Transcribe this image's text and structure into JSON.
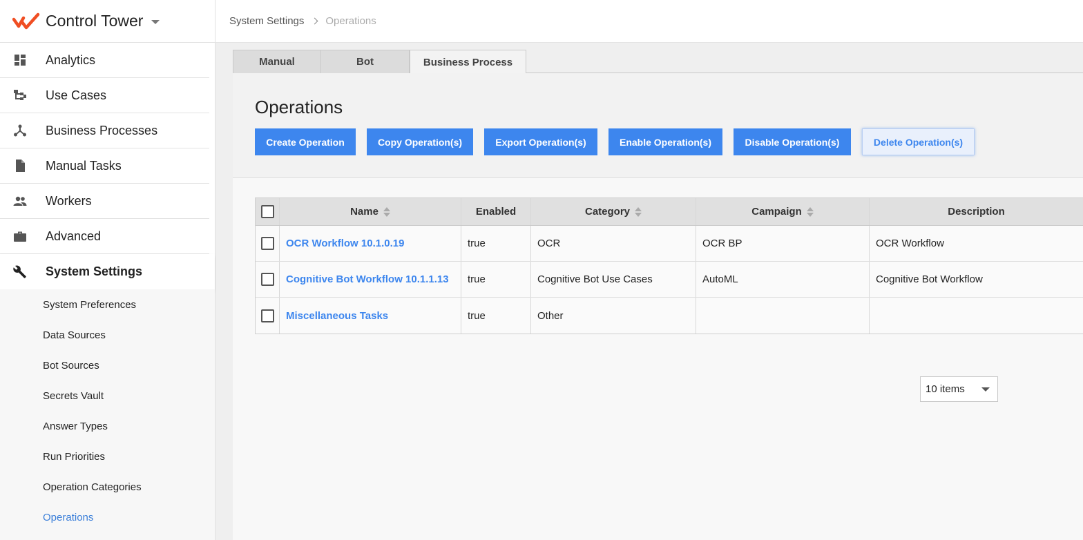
{
  "app": {
    "title": "Control Tower",
    "logo_icon": "control-tower-logo",
    "accent_color": "#f04e23"
  },
  "sidebar": {
    "items": [
      {
        "label": "Analytics",
        "icon": "dashboard-icon"
      },
      {
        "label": "Use Cases",
        "icon": "hierarchy-icon"
      },
      {
        "label": "Business Processes",
        "icon": "process-icon"
      },
      {
        "label": "Manual Tasks",
        "icon": "document-icon"
      },
      {
        "label": "Workers",
        "icon": "people-icon"
      },
      {
        "label": "Advanced",
        "icon": "briefcase-icon"
      },
      {
        "label": "System Settings",
        "icon": "wrench-icon"
      }
    ],
    "subitems": [
      "System Preferences",
      "Data Sources",
      "Bot Sources",
      "Secrets Vault",
      "Answer Types",
      "Run Priorities",
      "Operation Categories",
      "Operations"
    ],
    "active_item": "System Settings",
    "active_subitem": "Operations"
  },
  "breadcrumb": {
    "parent": "System Settings",
    "current": "Operations"
  },
  "tabs": [
    "Manual",
    "Bot",
    "Business Process"
  ],
  "active_tab": "Business Process",
  "page": {
    "title": "Operations",
    "buttons": {
      "create": "Create Operation",
      "copy": "Copy Operation(s)",
      "export": "Export Operation(s)",
      "enable": "Enable Operation(s)",
      "disable": "Disable Operation(s)",
      "delete": "Delete Operation(s)"
    }
  },
  "table": {
    "columns": [
      "Name",
      "Enabled",
      "Category",
      "Campaign",
      "Description"
    ],
    "rows": [
      {
        "name": "OCR Workflow 10.1.0.19",
        "enabled": "true",
        "category": "OCR",
        "campaign": "OCR BP",
        "description": "OCR Workflow"
      },
      {
        "name": "Cognitive Bot Workflow 10.1.1.13",
        "enabled": "true",
        "category": "Cognitive Bot Use Cases",
        "campaign": "AutoML",
        "description": "Cognitive Bot Workflow"
      },
      {
        "name": "Miscellaneous Tasks",
        "enabled": "true",
        "category": "Other",
        "campaign": "",
        "description": ""
      }
    ]
  },
  "pager": {
    "page_size": "10 items"
  },
  "colors": {
    "primary": "#3d86ee",
    "link": "#3d86ee"
  }
}
